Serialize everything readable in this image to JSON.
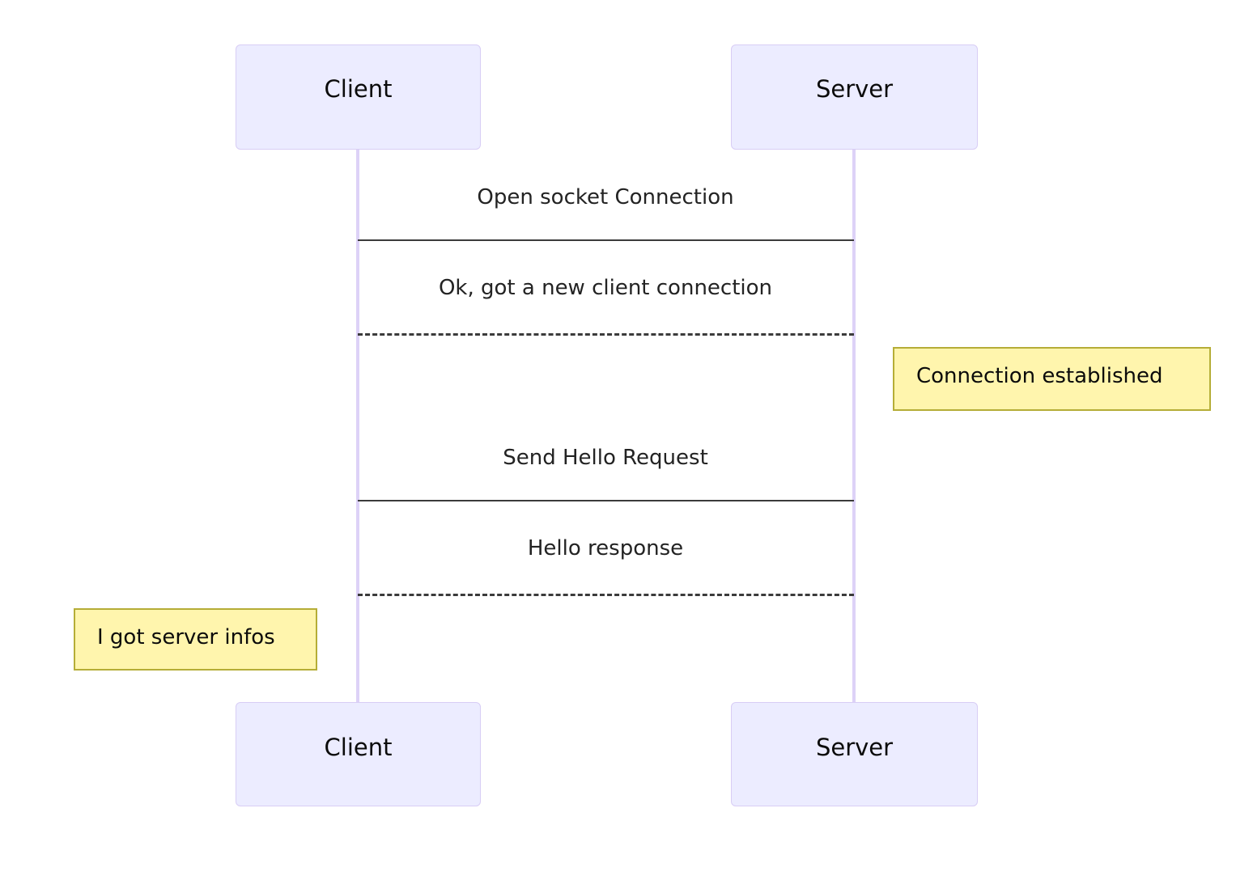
{
  "diagram": {
    "type": "sequence-diagram",
    "background_color": "#ffffff",
    "participants": [
      {
        "id": "client",
        "label": "Client"
      },
      {
        "id": "server",
        "label": "Server"
      }
    ],
    "messages": [
      {
        "index": 1,
        "label": "Open socket Connection",
        "from": "client",
        "to": "server",
        "line_style": "solid"
      },
      {
        "index": 2,
        "label": "Ok, got a new client connection",
        "from": "server",
        "to": "client",
        "line_style": "dashed"
      },
      {
        "index": 3,
        "label": "Send Hello Request",
        "from": "client",
        "to": "server",
        "line_style": "solid"
      },
      {
        "index": 4,
        "label": "Hello response",
        "from": "server",
        "to": "client",
        "line_style": "dashed"
      }
    ],
    "notes": [
      {
        "id": "note-connection-established",
        "label": "Connection established",
        "side": "right-of-server"
      },
      {
        "id": "note-server-infos",
        "label": "I got server infos",
        "side": "left-of-client"
      }
    ],
    "colors": {
      "actor_fill": "#ececff",
      "actor_border": "#d8cdf5",
      "lifeline": "#ddd2f7",
      "message_line": "#3b3b3b",
      "note_fill": "#fff5ad",
      "note_border": "#b5ad37",
      "text": "#0b0b0b"
    }
  }
}
